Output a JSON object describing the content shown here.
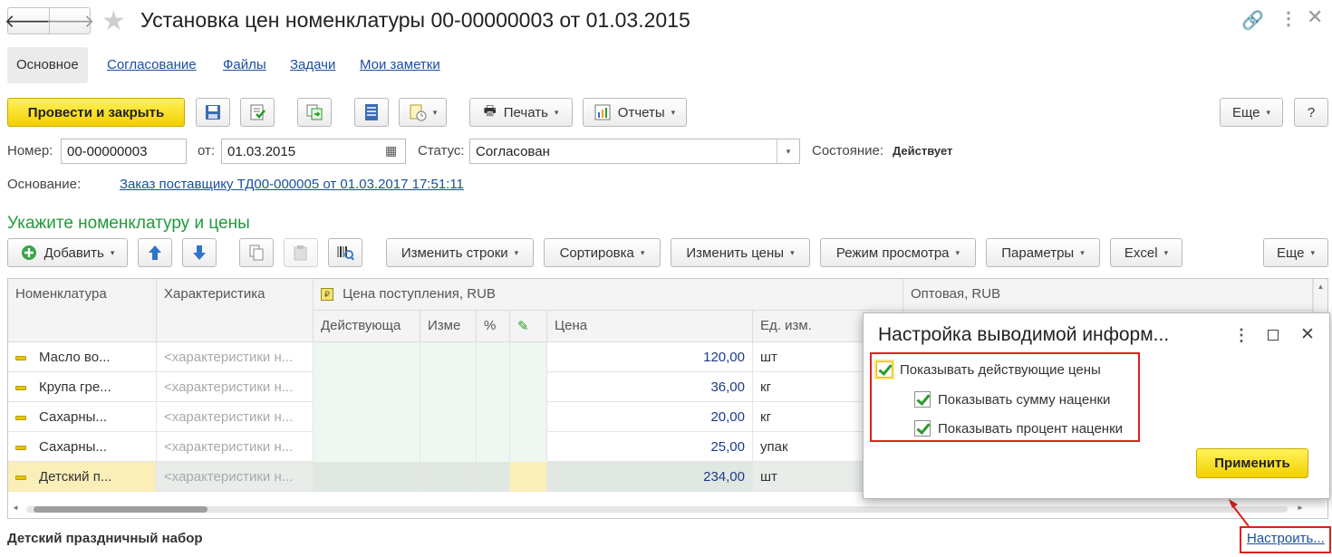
{
  "header": {
    "title": "Установка цен номенклатуры 00-00000003 от 01.03.2015",
    "back_glyph": "🡐",
    "forward_glyph": "🡒"
  },
  "tabs": [
    {
      "label": "Основное",
      "active": true
    },
    {
      "label": "Согласование"
    },
    {
      "label": "Файлы"
    },
    {
      "label": "Задачи"
    },
    {
      "label": "Мои заметки"
    }
  ],
  "toolbar": {
    "post_close_label": "Провести и закрыть",
    "print_label": "Печать",
    "reports_label": "Отчеты",
    "more_label": "Еще",
    "help_label": "?"
  },
  "form": {
    "number_label": "Номер:",
    "number_value": "00-00000003",
    "date_label": "от:",
    "date_value": "01.03.2015",
    "status_label": "Статус:",
    "status_value": "Согласован",
    "state_label": "Состояние:",
    "state_value": "Действует",
    "basis_label": "Основание:",
    "basis_value": "Заказ поставщику ТД00-000005 от 01.03.2017 17:51:11"
  },
  "section": {
    "title": "Укажите номенклатуру и цены"
  },
  "table_toolbar": {
    "add_label": "Добавить",
    "change_rows_label": "Изменить строки",
    "sort_label": "Сортировка",
    "change_prices_label": "Изменить цены",
    "view_mode_label": "Режим просмотра",
    "params_label": "Параметры",
    "excel_label": "Excel",
    "more_label": "Еще"
  },
  "table": {
    "headers": {
      "nomenclature": "Номенклатура",
      "characteristic": "Характеристика",
      "price_group": "Цена поступления, RUB",
      "wholesale_group": "Оптовая, RUB",
      "active": "Действующа",
      "change": "Изме",
      "percent": "%",
      "price": "Цена",
      "unit": "Ед. изм."
    },
    "rows": [
      {
        "name": "Масло во...",
        "characteristic": "<характеристики н...",
        "price": "120,00",
        "unit": "шт"
      },
      {
        "name": "Крупа гре...",
        "characteristic": "<характеристики н...",
        "price": "36,00",
        "unit": "кг"
      },
      {
        "name": "Сахарны...",
        "characteristic": "<характеристики н...",
        "price": "20,00",
        "unit": "кг"
      },
      {
        "name": "Сахарны...",
        "characteristic": "<характеристики н...",
        "price": "25,00",
        "unit": "упак"
      },
      {
        "name": "Детский п...",
        "characteristic": "<характеристики н...",
        "price": "234,00",
        "unit": "шт",
        "selected": true
      }
    ]
  },
  "footer": {
    "selected_item": "Детский праздничный набор",
    "configure_link": "Настроить..."
  },
  "popup": {
    "title": "Настройка выводимой информ...",
    "show_active_prices": "Показывать действующие цены",
    "show_markup_sum": "Показывать сумму наценки",
    "show_markup_percent": "Показывать процент наценки",
    "apply_label": "Применить"
  },
  "colors": {
    "accent_yellow": "#f5d800",
    "section_green": "#1f9a3c",
    "link_blue": "#1a4fa0",
    "highlight_red": "#e0201e"
  }
}
